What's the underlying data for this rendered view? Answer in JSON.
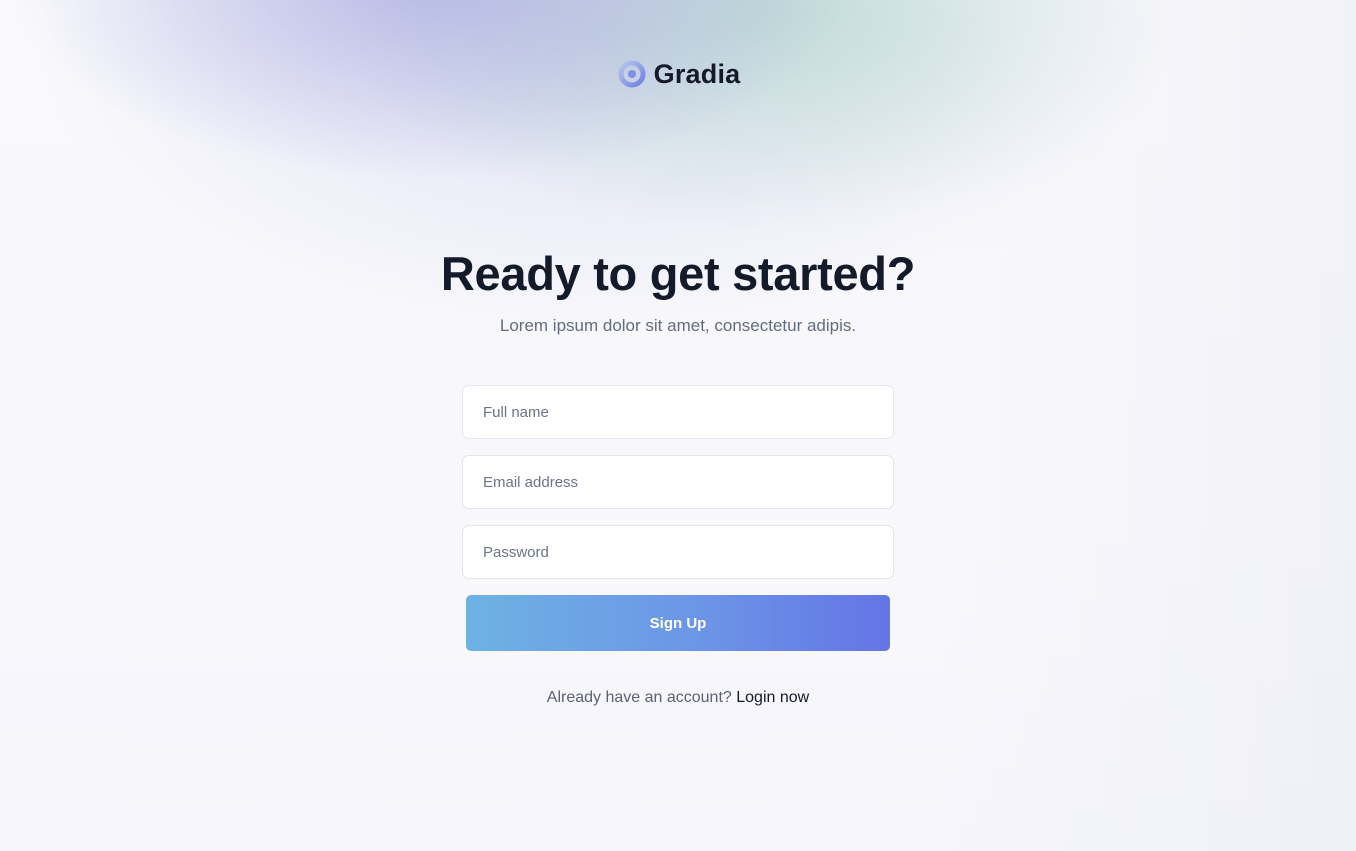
{
  "brand": {
    "name": "Gradia",
    "logo_icon": "ring-logo-icon",
    "accent_color": "#6b7be6"
  },
  "hero": {
    "title": "Ready to get started?",
    "subtitle": "Lorem ipsum dolor sit amet, consectetur adipis."
  },
  "form": {
    "full_name": {
      "placeholder": "Full name",
      "value": ""
    },
    "email": {
      "placeholder": "Email address",
      "value": ""
    },
    "password": {
      "placeholder": "Password",
      "value": ""
    },
    "submit_label": "Sign Up",
    "submit_gradient": [
      "#6eb2e4",
      "#6475e6"
    ]
  },
  "footer": {
    "prompt": "Already have an account?",
    "link_label": "Login now"
  }
}
